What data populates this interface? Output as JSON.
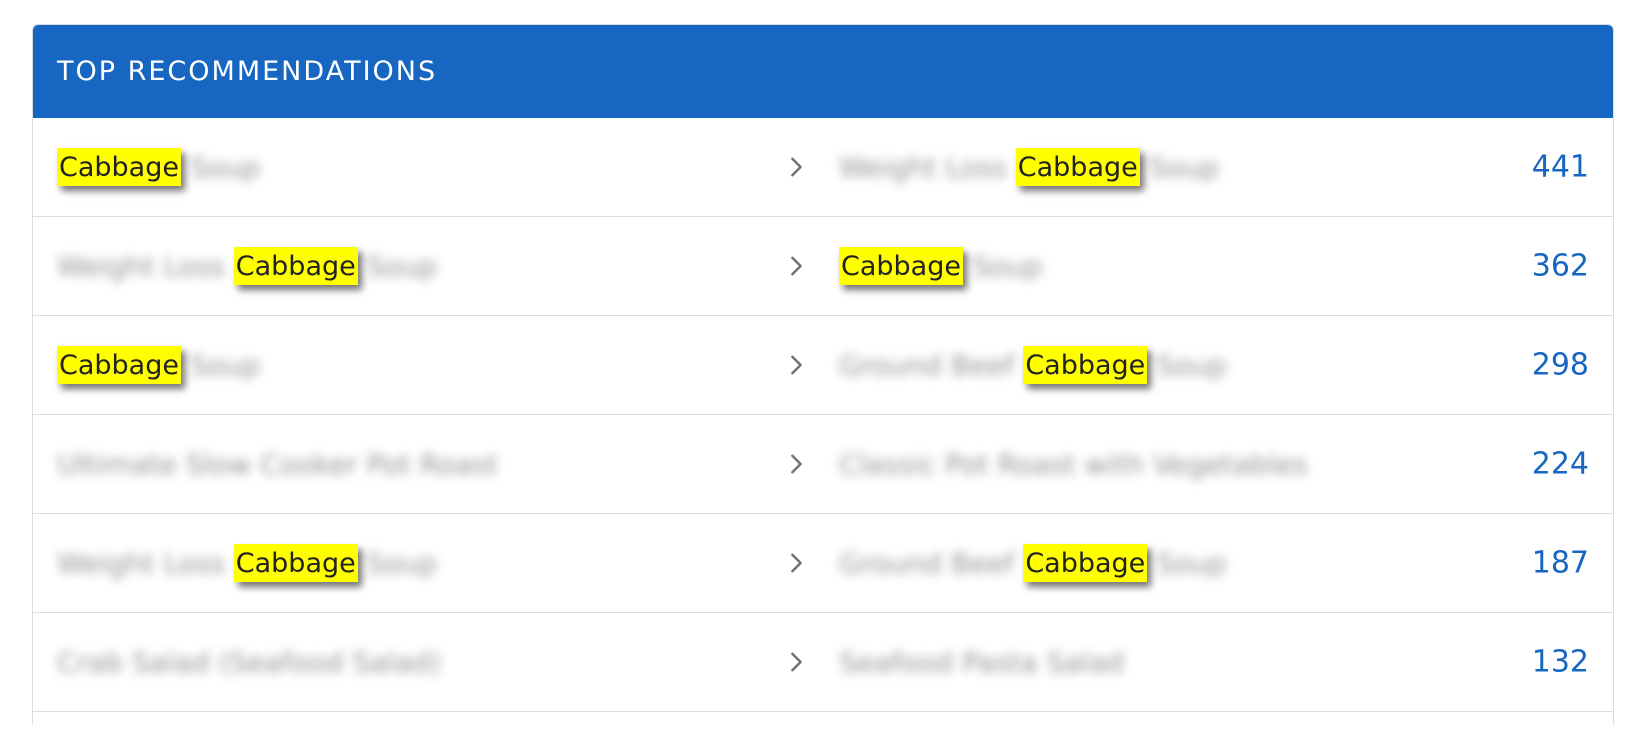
{
  "header": {
    "title": "TOP RECOMMENDATIONS"
  },
  "rows": [
    {
      "left": {
        "pre": "",
        "highlight": "Cabbage",
        "post": " Soup"
      },
      "right": {
        "pre": "Weight Loss ",
        "highlight": "Cabbage",
        "post": " Soup"
      },
      "count": "441"
    },
    {
      "left": {
        "pre": "Weight Loss ",
        "highlight": "Cabbage",
        "post": " Soup"
      },
      "right": {
        "pre": "",
        "highlight": "Cabbage",
        "post": " Soup"
      },
      "count": "362"
    },
    {
      "left": {
        "pre": "",
        "highlight": "Cabbage",
        "post": " Soup"
      },
      "right": {
        "pre": "Ground Beef ",
        "highlight": "Cabbage",
        "post": " Soup"
      },
      "count": "298"
    },
    {
      "left": {
        "pre": "Ultimate Slow Cooker Pot Roast",
        "highlight": "",
        "post": ""
      },
      "right": {
        "pre": "Classic Pot Roast with Vegetables",
        "highlight": "",
        "post": ""
      },
      "count": "224"
    },
    {
      "left": {
        "pre": "Weight Loss ",
        "highlight": "Cabbage",
        "post": " Soup"
      },
      "right": {
        "pre": "Ground Beef ",
        "highlight": "Cabbage",
        "post": " Soup"
      },
      "count": "187"
    },
    {
      "left": {
        "pre": "Crab Salad (Seafood Salad)",
        "highlight": "",
        "post": ""
      },
      "right": {
        "pre": "Seafood Pasta Salad",
        "highlight": "",
        "post": ""
      },
      "count": "132"
    }
  ],
  "icons": {
    "row_action": "chevron-right-icon"
  },
  "colors": {
    "header_bg": "#1766c2",
    "count_text": "#1766c2",
    "highlight": "#ffff00"
  }
}
